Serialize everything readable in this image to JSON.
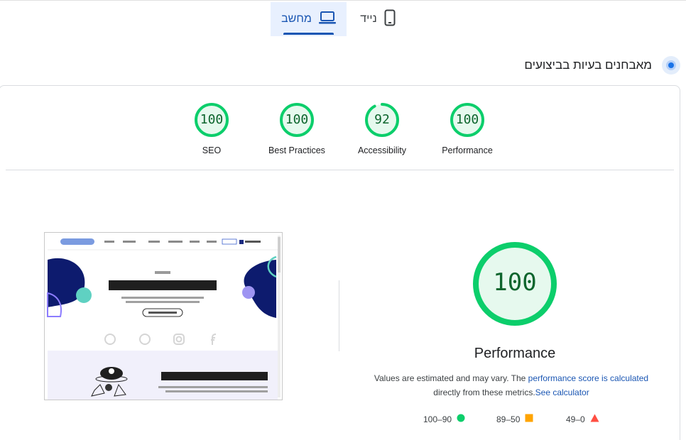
{
  "tabs": {
    "desktop_label": "מחשב",
    "mobile_label": "נייד"
  },
  "header": {
    "title": "מאבחנים בעיות בביצועים"
  },
  "scores": [
    {
      "label": "SEO",
      "value": "100",
      "score": 100
    },
    {
      "label": "Best Practices",
      "value": "100",
      "score": 100
    },
    {
      "label": "Accessibility",
      "value": "92",
      "score": 92
    },
    {
      "label": "Performance",
      "value": "100",
      "score": 100
    }
  ],
  "main_gauge": {
    "value": "100",
    "score": 100,
    "label": "Performance"
  },
  "note": {
    "text_before": "Values are estimated and may vary. The ",
    "link1": "performance score is calculated",
    "text_middle": " directly from these metrics.",
    "link2": "See calculator"
  },
  "legend": [
    {
      "range": "100–90",
      "shape": "circle",
      "color": "#0cce6b"
    },
    {
      "range": "89–50",
      "shape": "square",
      "color": "#ffa400"
    },
    {
      "range": "49–0",
      "shape": "triangle",
      "color": "#ff4e42"
    }
  ],
  "colors": {
    "pass": "#0cce6b",
    "pass_bg": "#e6f9ee",
    "accent": "#1a56b3",
    "thumb_navy": "#0d1b6e",
    "thumb_teal": "#5fd1c2"
  },
  "thumbnail": {
    "nav_items": [
      "בית",
      "מי אנחנו",
      "שירותים",
      "תיק עבודות",
      "מאמרים",
      "אתרים שבנינו",
      "צור קשר"
    ],
    "cta": "לקבלת הצעה",
    "kicker": "נדב אפשר",
    "hero_title": "בנייה וקידום אתרים שמוכרים",
    "hero_button": "בואו נעדיף על אתר העסק",
    "section_title": "מי אנחנו ועם מי אנחנו עובדים?"
  }
}
